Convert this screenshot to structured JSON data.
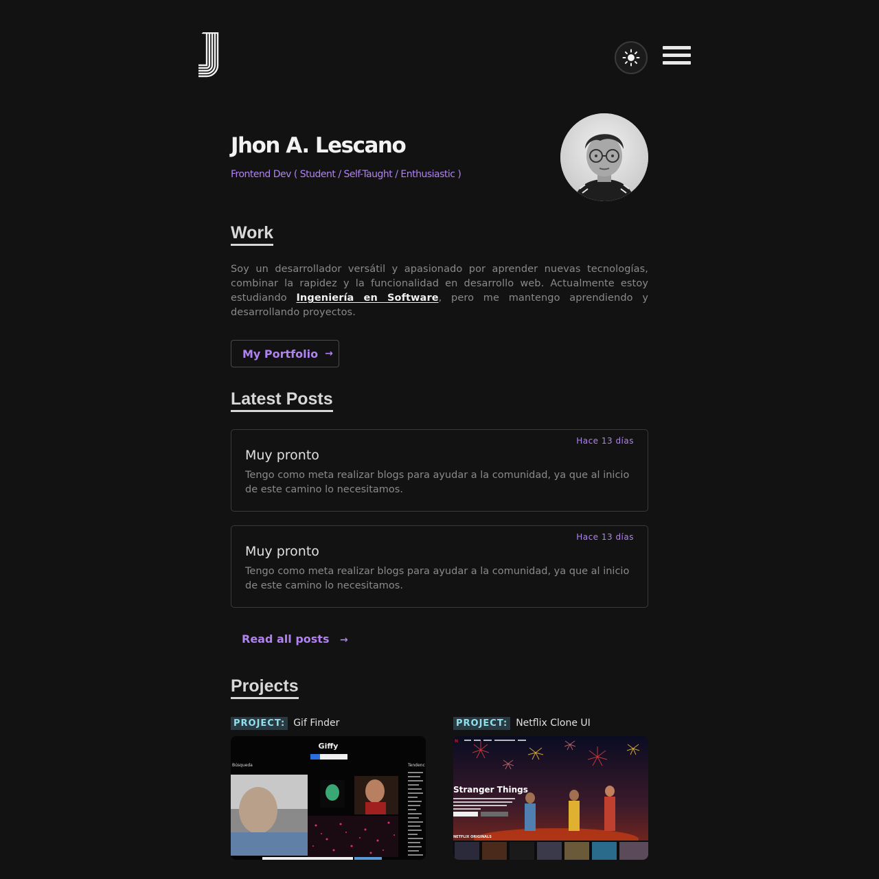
{
  "header": {
    "logo_alt": "J",
    "theme_toggle_icon": "sun-icon",
    "menu_icon": "hamburger-menu-icon"
  },
  "hero": {
    "name": "Jhon A. Lescano",
    "role": "Frontend Dev ( Student / Self-Taught / Enthusiastic )"
  },
  "work": {
    "title": "Work",
    "text_before": "Soy un desarrollador versátil y apasionado por aprender nuevas tecnologías, combinar la rapidez y la funcionalidad en desarrollo web. Actualmente estoy estudiando ",
    "link_text": "Ingeniería en Software",
    "text_after": ", pero me mantengo aprendiendo y desarrollando proyectos.",
    "button_label": "My Portfolio",
    "button_arrow": "→"
  },
  "posts": {
    "title": "Latest Posts",
    "items": [
      {
        "date": "Hace 13 días",
        "title": "Muy pronto",
        "body": "Tengo como meta realizar blogs para ayudar a la comunidad, ya que al inicio de este camino lo necesitamos."
      },
      {
        "date": "Hace 13 días",
        "title": "Muy pronto",
        "body": "Tengo como meta realizar blogs para ayudar a la comunidad, ya que al inicio de este camino lo necesitamos."
      }
    ],
    "read_all_label": "Read all posts",
    "read_all_arrow": "→"
  },
  "projects": {
    "title": "Projects",
    "items": [
      {
        "tag": "PROJECT:",
        "name": "Gif Finder",
        "thumb": {
          "app_title": "Giffy",
          "left_label": "Búsqueda",
          "right_label": "Tendenc"
        }
      },
      {
        "tag": "PROJECT:",
        "name": "Netflix Clone UI",
        "thumb": {
          "hero_title": "Stranger Things",
          "row_label": "NETFLIX ORIGINALS"
        }
      }
    ]
  },
  "colors": {
    "background": "#121212",
    "accent": "#b083f0",
    "tag_bg": "#2a3a40",
    "tag_text": "#8fe0ee"
  }
}
